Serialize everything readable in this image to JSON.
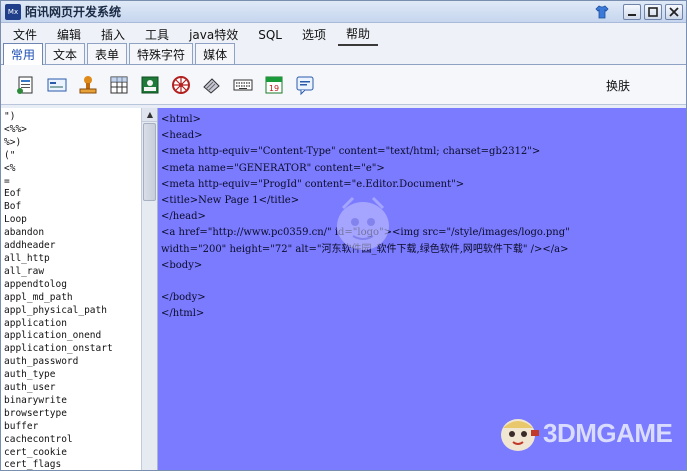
{
  "window": {
    "title": "陌讯网页开发系统",
    "app_icon_text": "Mx"
  },
  "menu": [
    "文件",
    "编辑",
    "插入",
    "工具",
    "java特效",
    "SQL",
    "选项",
    "帮助"
  ],
  "tabs": [
    "常用",
    "文本",
    "表单",
    "特殊字符",
    "媒体"
  ],
  "toolbar": {
    "icons": [
      "document-icon",
      "form-icon",
      "stamp-icon",
      "table-icon",
      "image-icon",
      "wheel-icon",
      "eraser-icon",
      "keyboard-icon",
      "calendar-icon",
      "dialog-icon"
    ],
    "calendar_text": "19",
    "skin_label": "换肤"
  },
  "keywords": [
    "\")",
    "<%%>",
    "%>)",
    "(\"",
    "<%",
    "=",
    "Eof",
    "Bof",
    "Loop",
    "abandon",
    "addheader",
    "all_http",
    "all_raw",
    "appendtolog",
    "appl_md_path",
    "appl_physical_path",
    "application",
    "application_onend",
    "application_onstart",
    "auth_password",
    "auth_type",
    "auth_user",
    "binarywrite",
    "browsertype",
    "buffer",
    "cachecontrol",
    "cert_cookie",
    "cert_flags"
  ],
  "code_lines": [
    "<html>",
    "<head>",
    "<meta http-equiv=\"Content-Type\" content=\"text/html; charset=gb2312\">",
    "<meta name=\"GENERATOR\" content=\"e\">",
    "<meta http-equiv=\"ProgId\" content=\"e.Editor.Document\">",
    "<title>New Page 1</title>",
    "</head>",
    "<a href=\"http://www.pc0359.cn/\" id=\"logo\"><img src=\"/style/images/logo.png\"",
    "width=\"200\" height=\"72\" alt=\"河东软件园_软件下载,绿色软件,网吧软件下载\" /></a>",
    "<body>",
    "",
    "</body>",
    "</html>"
  ],
  "watermark": {
    "text": "3DMGAME"
  },
  "colors": {
    "editor_bg": "#7b7bff",
    "accent": "#1b4fb5"
  }
}
